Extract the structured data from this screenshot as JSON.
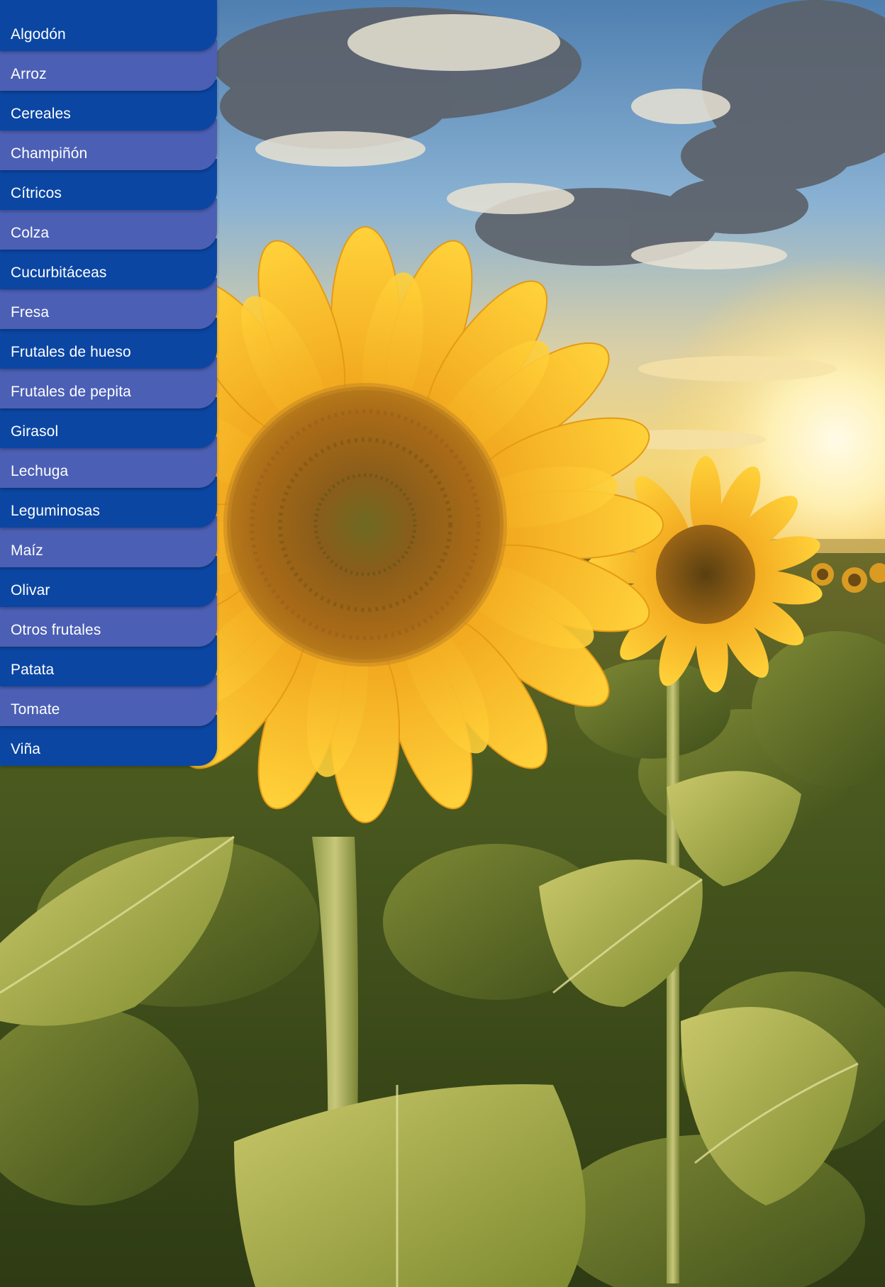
{
  "menu": {
    "items": [
      {
        "label": "Algodón"
      },
      {
        "label": "Arroz"
      },
      {
        "label": "Cereales"
      },
      {
        "label": "Champiñón"
      },
      {
        "label": "Cítricos"
      },
      {
        "label": "Colza"
      },
      {
        "label": "Cucurbitáceas"
      },
      {
        "label": "Fresa"
      },
      {
        "label": "Frutales de hueso"
      },
      {
        "label": "Frutales de pepita"
      },
      {
        "label": "Girasol"
      },
      {
        "label": "Lechuga"
      },
      {
        "label": "Leguminosas"
      },
      {
        "label": "Maíz"
      },
      {
        "label": "Olivar"
      },
      {
        "label": "Otros frutales"
      },
      {
        "label": "Patata"
      },
      {
        "label": "Tomate"
      },
      {
        "label": "Viña"
      }
    ],
    "colors": {
      "dark": "#0b46a3",
      "light": "#4b5fb5",
      "text": "#ffffff"
    }
  },
  "background": {
    "subject": "sunflower-field-at-sunset"
  }
}
